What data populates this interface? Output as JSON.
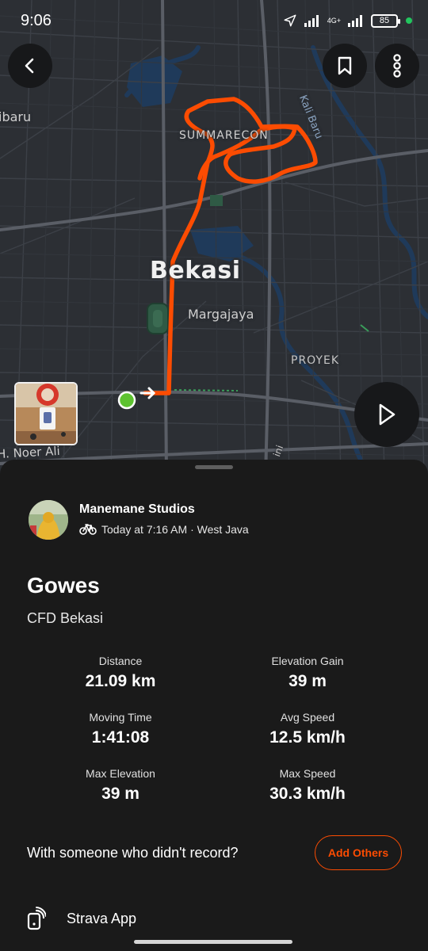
{
  "status_bar": {
    "time": "9:06",
    "network_label_top": "4G+",
    "battery": "85",
    "icons": [
      "location-arrow-icon",
      "signal-icon",
      "signal-icon",
      "battery-icon",
      "green-privacy-dot"
    ]
  },
  "map": {
    "labels": {
      "city": "Bekasi",
      "summarecon": "SUMMARECON",
      "margajaya": "Margajaya",
      "proyek": "PROYEK",
      "ibaru": "ibaru",
      "noerali": "H. Noer Ali",
      "kalibaru": "Kali Baru",
      "ini": "ini"
    },
    "route_color": "#fc4c02",
    "start_marker_color": "#5dc230"
  },
  "header_buttons": {
    "back": "back-arrow-icon",
    "bookmark": "bookmark-icon",
    "more": "more-vertical-icon",
    "play": "play-icon"
  },
  "activity": {
    "athlete_name": "Manemane Studios",
    "meta": "Today at 7:16 AM · West Java",
    "sport_icon": "bicycle-icon",
    "title": "Gowes",
    "description": "CFD Bekasi"
  },
  "stats": [
    {
      "label": "Distance",
      "value": "21.09 km"
    },
    {
      "label": "Elevation Gain",
      "value": "39 m"
    },
    {
      "label": "Moving Time",
      "value": "1:41:08"
    },
    {
      "label": "Avg Speed",
      "value": "12.5 km/h"
    },
    {
      "label": "Max Elevation",
      "value": "39 m"
    },
    {
      "label": "Max Speed",
      "value": "30.3 km/h"
    }
  ],
  "with_others": {
    "prompt": "With someone who didn't record?",
    "button": "Add Others"
  },
  "device": {
    "label": "Strava App",
    "icon": "phone-device-icon"
  },
  "colors": {
    "accent": "#fc4c02",
    "sheet_bg": "#1a1a1a",
    "map_bg": "#2c2f34"
  }
}
